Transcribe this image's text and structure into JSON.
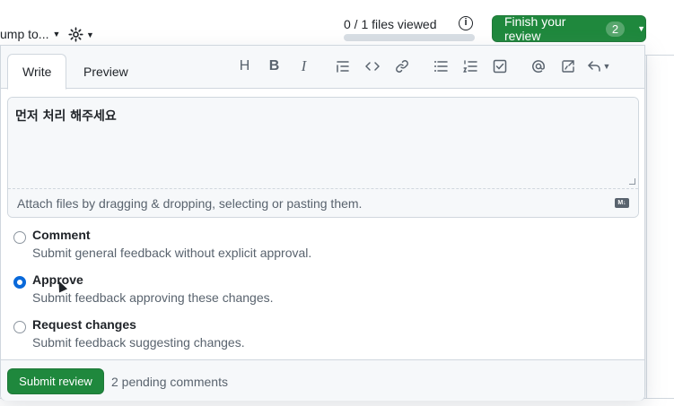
{
  "header": {
    "jump_label": "ump to...",
    "files_viewed": "0 / 1 files viewed",
    "files_viewed_progress": 0,
    "finish_label": "Finish your review",
    "finish_count": "2"
  },
  "tabs": [
    {
      "label": "Write",
      "active": true
    },
    {
      "label": "Preview",
      "active": false
    }
  ],
  "toolbar": {
    "icons": [
      "heading-icon",
      "bold-icon",
      "italic-icon",
      "quote-icon",
      "code-icon",
      "link-icon",
      "unordered-list-icon",
      "ordered-list-icon",
      "task-list-icon",
      "mention-icon",
      "cross-reference-icon",
      "reply-icon"
    ],
    "heading": "H",
    "bold": "B",
    "italic": "I"
  },
  "editor": {
    "value": "먼저 처리 해주세요",
    "attach_hint": "Attach files by dragging & dropping, selecting or pasting them.",
    "markdown_badge": "M↓"
  },
  "options": [
    {
      "title": "Comment",
      "description": "Submit general feedback without explicit approval.",
      "checked": false
    },
    {
      "title": "Approve",
      "description": "Submit feedback approving these changes.",
      "checked": true
    },
    {
      "title": "Request changes",
      "description": "Submit feedback suggesting changes.",
      "checked": false
    }
  ],
  "footer": {
    "submit_label": "Submit review",
    "pending": "2 pending comments"
  },
  "colors": {
    "primary_green": "#1f883d",
    "radio_blue": "#0969da",
    "muted_text": "#59636e"
  }
}
